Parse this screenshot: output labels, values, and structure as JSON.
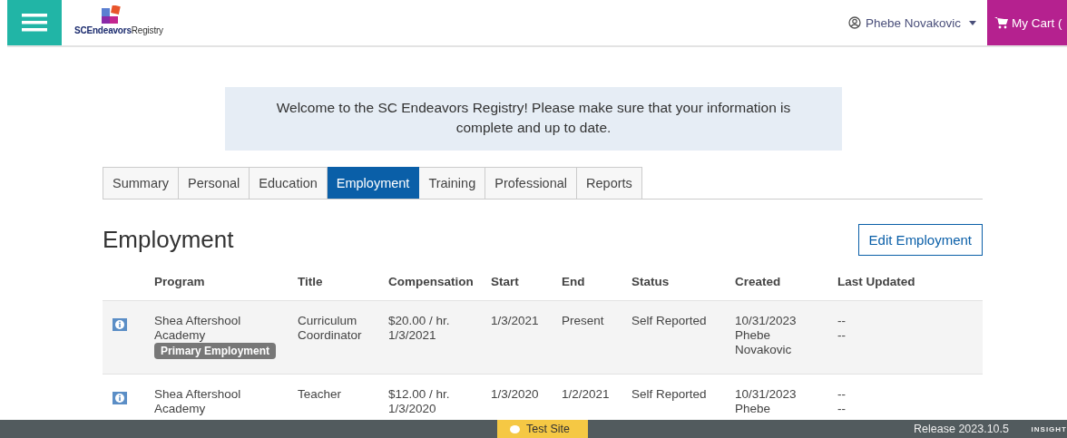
{
  "header": {
    "logo": {
      "brand_bold": "SCEndeavors",
      "brand_light": "Registry"
    },
    "user": "Phebe Novakovic",
    "cart": "My Cart ("
  },
  "banner": "Welcome to the SC Endeavors Registry! Please make sure that your information is complete and up to date.",
  "tabs": [
    {
      "label": "Summary",
      "selected": false
    },
    {
      "label": "Personal",
      "selected": false
    },
    {
      "label": "Education",
      "selected": false
    },
    {
      "label": "Employment",
      "selected": true
    },
    {
      "label": "Training",
      "selected": false
    },
    {
      "label": "Professional",
      "selected": false
    },
    {
      "label": "Reports",
      "selected": false
    }
  ],
  "section": {
    "title": "Employment",
    "edit_button": "Edit Employment"
  },
  "table": {
    "columns": [
      "Program",
      "Title",
      "Compensation",
      "Start",
      "End",
      "Status",
      "Created",
      "Last Updated"
    ],
    "rows": [
      {
        "program": "Shea Aftershool Academy",
        "badge": "Primary Employment",
        "title": "Curriculum Coordinator",
        "compensation": [
          "$20.00 / hr.",
          "1/3/2021"
        ],
        "start": "1/3/2021",
        "end": "Present",
        "status": "Self Reported",
        "created": [
          "10/31/2023",
          "Phebe",
          "Novakovic"
        ],
        "last_updated": [
          "--",
          "--"
        ],
        "highlighted": true
      },
      {
        "program": "Shea Aftershool Academy",
        "title": "Teacher",
        "compensation": [
          "$12.00 / hr.",
          "1/3/2020"
        ],
        "start": "1/3/2020",
        "end": "1/2/2021",
        "status": "Self Reported",
        "created": [
          "10/31/2023",
          "Phebe"
        ],
        "last_updated": [
          "--",
          "--"
        ],
        "highlighted": false
      }
    ]
  },
  "footer": {
    "site_label": "Test Site",
    "release": "Release 2023.10.5",
    "brand": "INSIGHT"
  }
}
